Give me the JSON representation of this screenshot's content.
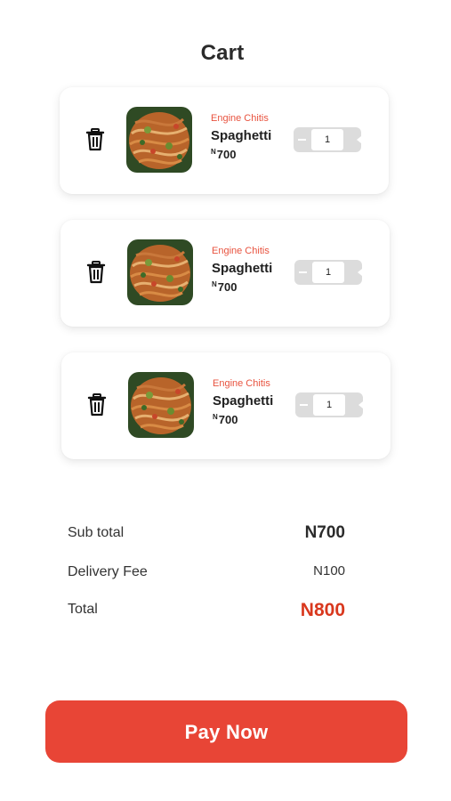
{
  "header": {
    "title": "Cart"
  },
  "cart": {
    "items": [
      {
        "vendor": "Engine Chitis",
        "name": "Spaghetti",
        "currency": "N",
        "price": "700",
        "quantity": "1"
      },
      {
        "vendor": "Engine Chitis",
        "name": "Spaghetti",
        "currency": "N",
        "price": "700",
        "quantity": "1"
      },
      {
        "vendor": "Engine Chitis",
        "name": "Spaghetti",
        "currency": "N",
        "price": "700",
        "quantity": "1"
      }
    ]
  },
  "summary": {
    "subtotal_label": "Sub total",
    "subtotal_value": "N700",
    "delivery_label": "Delivery Fee",
    "delivery_value": "N100",
    "total_label": "Total",
    "total_value": "N800"
  },
  "actions": {
    "pay_label": "Pay Now"
  },
  "colors": {
    "accent": "#e84536",
    "total_text": "#d9381e",
    "vendor_text": "#e8533f"
  },
  "icons": {
    "delete": "trash-icon"
  }
}
